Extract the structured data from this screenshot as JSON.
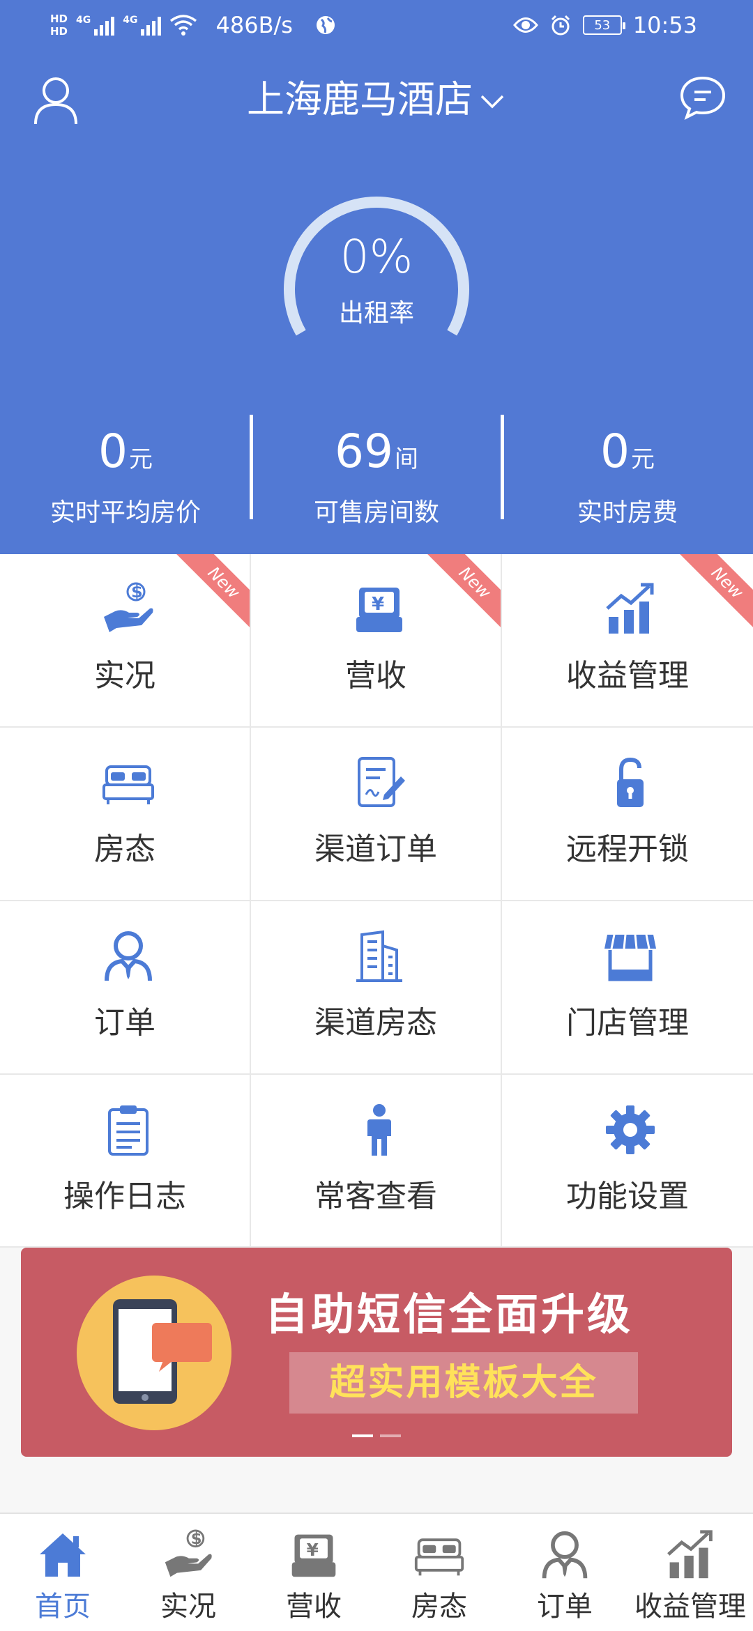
{
  "status_bar": {
    "network_speed": "486B/s",
    "hd1": "HD",
    "hd2": "HD",
    "net1": "4G",
    "net2": "4G",
    "battery": "53",
    "time": "10:53"
  },
  "header": {
    "hotel_name": "上海鹿马酒店",
    "occupancy_value": "0%",
    "occupancy_label": "出租率",
    "occupancy_fraction": 0
  },
  "stats": [
    {
      "value": "0",
      "unit": "元",
      "label": "实时平均房价"
    },
    {
      "value": "69",
      "unit": "间",
      "label": "可售房间数"
    },
    {
      "value": "0",
      "unit": "元",
      "label": "实时房费"
    }
  ],
  "grid": [
    {
      "label": "实况",
      "icon": "hand-money-icon",
      "badge": "New"
    },
    {
      "label": "营收",
      "icon": "cash-register-icon",
      "badge": "New"
    },
    {
      "label": "收益管理",
      "icon": "bar-chart-up-icon",
      "badge": "New"
    },
    {
      "label": "房态",
      "icon": "bed-icon",
      "badge": ""
    },
    {
      "label": "渠道订单",
      "icon": "edit-document-icon",
      "badge": ""
    },
    {
      "label": "远程开锁",
      "icon": "unlock-icon",
      "badge": ""
    },
    {
      "label": "订单",
      "icon": "staff-badge-icon",
      "badge": ""
    },
    {
      "label": "渠道房态",
      "icon": "building-icon",
      "badge": ""
    },
    {
      "label": "门店管理",
      "icon": "store-icon",
      "badge": ""
    },
    {
      "label": "操作日志",
      "icon": "clipboard-icon",
      "badge": ""
    },
    {
      "label": "常客查看",
      "icon": "person-icon",
      "badge": ""
    },
    {
      "label": "功能设置",
      "icon": "gear-icon",
      "badge": ""
    }
  ],
  "banner": {
    "title": "自助短信全面升级",
    "subtitle": "超实用模板大全",
    "slide_count": 2,
    "active_slide": 1
  },
  "tabs": [
    {
      "label": "首页",
      "icon": "home-icon",
      "active": true
    },
    {
      "label": "实况",
      "icon": "hand-money-icon",
      "active": false
    },
    {
      "label": "营收",
      "icon": "cash-register-icon",
      "active": false
    },
    {
      "label": "房态",
      "icon": "bed-icon",
      "active": false
    },
    {
      "label": "订单",
      "icon": "staff-badge-icon",
      "active": false
    },
    {
      "label": "收益管理",
      "icon": "bar-chart-up-icon",
      "active": false
    }
  ],
  "colors": {
    "primary": "#5279d4",
    "icon_blue": "#4c7bd6",
    "ribbon": "#f07d7d",
    "banner_bg": "#c75b64",
    "tab_inactive": "#777777"
  }
}
